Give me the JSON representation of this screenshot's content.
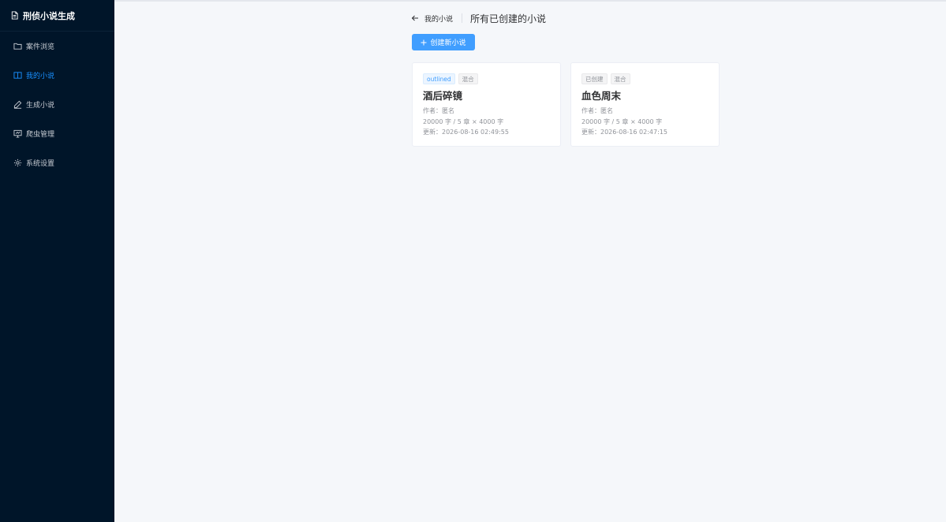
{
  "app": {
    "title": "刑侦小说生成"
  },
  "sidebar": {
    "items": [
      {
        "label": "案件浏览",
        "icon": "folder-icon",
        "active": false
      },
      {
        "label": "我的小说",
        "icon": "book-icon",
        "active": true
      },
      {
        "label": "生成小说",
        "icon": "pen-icon",
        "active": false
      },
      {
        "label": "爬虫管理",
        "icon": "monitor-icon",
        "active": false
      },
      {
        "label": "系统设置",
        "icon": "gear-icon",
        "active": false
      }
    ]
  },
  "header": {
    "back_label": "我的小说",
    "title": "所有已创建的小说"
  },
  "toolbar": {
    "create_label": "创建新小说"
  },
  "colors": {
    "sidebar_bg": "#001529",
    "accent": "#409eff",
    "active_menu": "#1890ff",
    "page_bg": "#f5f7fa"
  },
  "novels": [
    {
      "status": "outlined",
      "status_style": "primary",
      "genre": "混合",
      "title": "酒后碎镜",
      "author": "作者：匿名",
      "length": "20000 字 / 5 章 × 4000 字",
      "updated": "更新：2026-08-16 02:49:55"
    },
    {
      "status": "已创建",
      "status_style": "info",
      "genre": "混合",
      "title": "血色周末",
      "author": "作者：匿名",
      "length": "20000 字 / 5 章 × 4000 字",
      "updated": "更新：2026-08-16 02:47:15"
    }
  ]
}
